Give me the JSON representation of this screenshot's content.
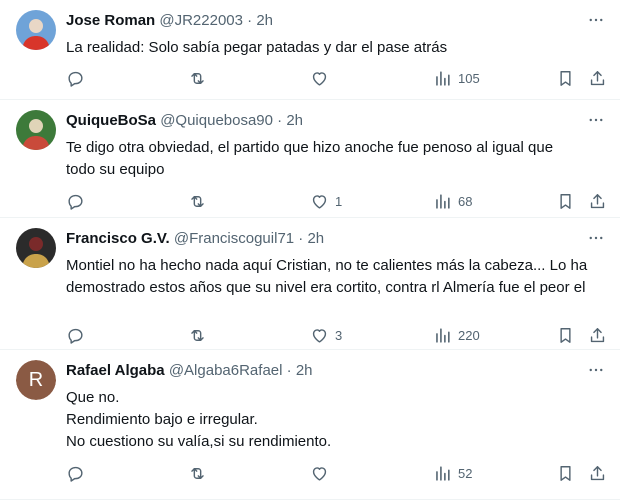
{
  "tweets": [
    {
      "name": "Jose Roman",
      "handle": "@JR222003",
      "time": "2h",
      "lines": [
        "La realidad: Solo sabía pegar patadas y dar el pase atrás"
      ],
      "replies": "",
      "retweets": "",
      "likes": "",
      "views": "105",
      "avatar": {
        "kind": "photo",
        "colors": [
          "#6fa3d8",
          "#d8352a",
          "#e9d7c6"
        ]
      }
    },
    {
      "name": "QuiqueBoSa",
      "handle": "@Quiquebosa90",
      "time": "2h",
      "lines": [
        "Te digo otra obviedad, el partido que hizo anoche fue penoso al igual que",
        "todo su equipo"
      ],
      "replies": "",
      "retweets": "",
      "likes": "1",
      "views": "68",
      "avatar": {
        "kind": "photo",
        "colors": [
          "#3d7a3a",
          "#c94a3a",
          "#e0d4b8"
        ]
      }
    },
    {
      "name": "Francisco G.V.",
      "handle": "@Franciscoguil71",
      "time": "2h",
      "lines": [
        "Montiel no ha hecho nada aquí Cristian, no te calientes más la cabeza... Lo ha",
        "demostrado estos años que su nivel era cortito, contra rl Almería fue el peor el"
      ],
      "replies": "",
      "retweets": "",
      "likes": "3",
      "views": "220",
      "avatar": {
        "kind": "photo",
        "colors": [
          "#2b2b2b",
          "#c9a24a",
          "#7a2a2a"
        ]
      }
    },
    {
      "name": "Rafael Algaba",
      "handle": "@Algaba6Rafael",
      "time": "2h",
      "lines": [
        "Que no.",
        "Rendimiento bajo e irregular.",
        "No cuestiono su valía,si su rendimiento."
      ],
      "replies": "",
      "retweets": "",
      "likes": "",
      "views": "52",
      "avatar": {
        "kind": "letter",
        "letter": "R",
        "color": "#8a5a44"
      }
    }
  ],
  "icons": {
    "more": "more-horizontal-icon",
    "reply": "reply-icon",
    "retweet": "retweet-icon",
    "like": "heart-icon",
    "views": "views-chart-icon",
    "bookmark": "bookmark-icon",
    "share": "share-icon"
  },
  "colors": {
    "text": "#0f1419",
    "secondary": "#536471",
    "divider": "#eff3f4"
  }
}
